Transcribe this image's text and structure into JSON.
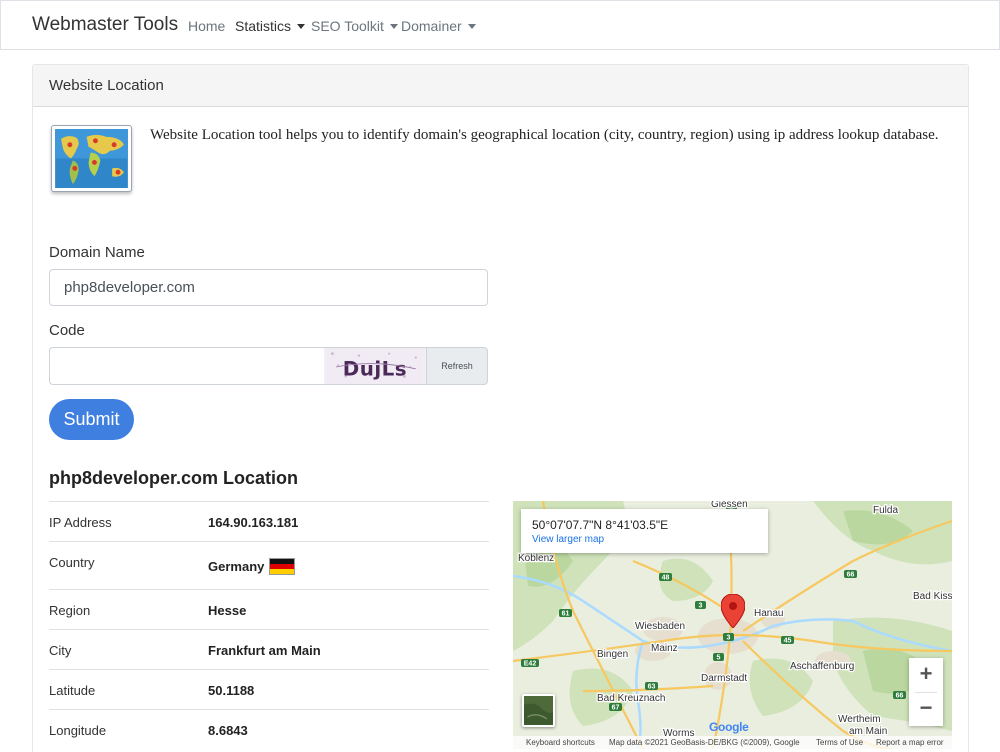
{
  "navbar": {
    "brand": "Webmaster Tools",
    "items": [
      {
        "label": "Home",
        "dropdown": false
      },
      {
        "label": "Statistics",
        "dropdown": true
      },
      {
        "label": "SEO Toolkit",
        "dropdown": true
      },
      {
        "label": "Domainer",
        "dropdown": true
      }
    ]
  },
  "card": {
    "header": "Website Location",
    "intro": "Website Location tool helps you to identify domain's geographical location (city, country, region) using ip address lookup database.",
    "icon": "world-map-icon"
  },
  "form": {
    "domain_label": "Domain Name",
    "domain_value": "php8developer.com",
    "code_label": "Code",
    "code_value": "",
    "captcha_text": "DujLs",
    "refresh_label": "Refresh",
    "submit_label": "Submit"
  },
  "result": {
    "title": "php8developer.com Location",
    "rows": [
      {
        "key": "IP Address",
        "value": "164.90.163.181"
      },
      {
        "key": "Country",
        "value": "Germany",
        "flag": "de-flag-icon"
      },
      {
        "key": "Region",
        "value": "Hesse"
      },
      {
        "key": "City",
        "value": "Frankfurt am Main"
      },
      {
        "key": "Latitude",
        "value": "50.1188"
      },
      {
        "key": "Longitude",
        "value": "8.6843"
      }
    ]
  },
  "map": {
    "coords": "50°07'07.7\"N 8°41'03.5\"E",
    "larger_link": "View larger map",
    "zoom_in": "+",
    "zoom_out": "−",
    "places": [
      "Giessen",
      "Fulda",
      "Koblenz",
      "Wiesbaden",
      "Hanau",
      "Mainz",
      "Bingen",
      "Aschaffenburg",
      "Darmstadt",
      "Bad Kreuznach",
      "Bad Kiss",
      "Worms",
      "Wertheim",
      "am Main"
    ],
    "road_numbers": [
      "5",
      "66",
      "48",
      "61",
      "3",
      "45",
      "E42",
      "63",
      "67",
      "66",
      "5",
      "3"
    ],
    "footer": {
      "shortcuts": "Keyboard shortcuts",
      "data": "Map data ©2021 GeoBasis-DE/BKG (©2009), Google",
      "terms": "Terms of Use",
      "report": "Report a map error"
    },
    "logo": "Google",
    "colors": {
      "land": "#e9eedf",
      "forest": "#c9dfb5",
      "highway": "#f6c85f",
      "river": "#aadaff",
      "pin": "#ea4335"
    }
  }
}
